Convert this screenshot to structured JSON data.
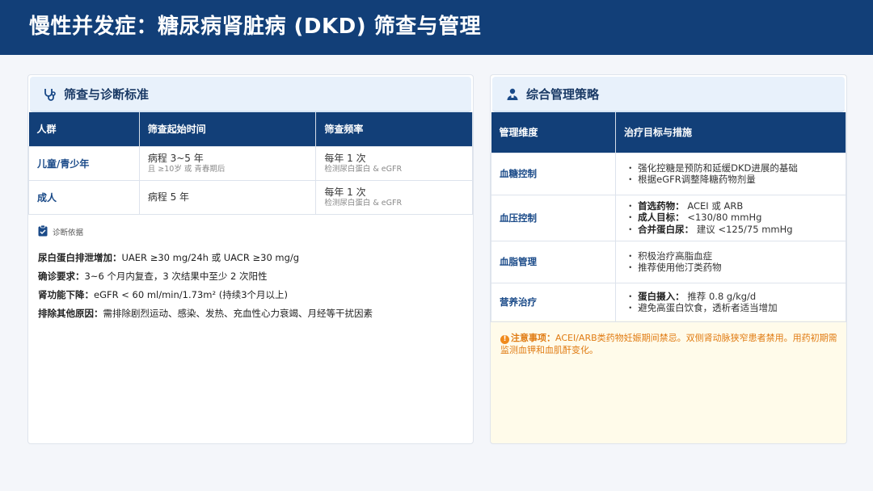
{
  "page_title": "慢性并发症：糖尿病肾脏病 (DKD) 筛查与管理",
  "colors": {
    "header_bg": "#123f78",
    "accent": "#1a4a88",
    "warning": "#e07b12",
    "note_bg": "#fffbea"
  },
  "screening": {
    "title": "筛查与诊断标准",
    "icon": "stethoscope-icon",
    "headers": [
      "人群",
      "筛查起始时间",
      "筛查频率"
    ],
    "rows": [
      {
        "group": "儿童/青少年",
        "start_main": "病程 3~5 年",
        "start_sub": "且 ≥10岁 或 青春期后",
        "freq_main": "每年 1 次",
        "freq_sub": "检测尿白蛋白 & eGFR"
      },
      {
        "group": "成人",
        "start_main": "病程 5 年",
        "start_sub": "",
        "freq_main": "每年 1 次",
        "freq_sub": "检测尿白蛋白 & eGFR"
      }
    ],
    "basis_label": "诊断依据",
    "criteria": [
      {
        "label": "尿白蛋白排泄增加：",
        "text": "UAER ≥30 mg/24h 或 UACR ≥30 mg/g"
      },
      {
        "label": "确诊要求：",
        "text": "3~6 个月内复查，3 次结果中至少 2 次阳性"
      },
      {
        "label": "肾功能下降：",
        "text": "eGFR < 60 ml/min/1.73m² (持续3个月以上)"
      },
      {
        "label": "排除其他原因：",
        "text": "需排除剧烈运动、感染、发热、充血性心力衰竭、月经等干扰因素"
      }
    ]
  },
  "management": {
    "title": "综合管理策略",
    "icon": "person-icon",
    "headers": [
      "管理维度",
      "治疗目标与措施"
    ],
    "rows": [
      {
        "dim": "血糖控制",
        "items": [
          {
            "label": "",
            "text": "强化控糖是预防和延缓DKD进展的基础"
          },
          {
            "label": "",
            "text": "根据eGFR调整降糖药物剂量"
          }
        ]
      },
      {
        "dim": "血压控制",
        "items": [
          {
            "label": "首选药物：",
            "text": "ACEI 或 ARB"
          },
          {
            "label": "成人目标：",
            "text": "<130/80 mmHg"
          },
          {
            "label": "合并蛋白尿：",
            "text": "建议 <125/75 mmHg"
          }
        ]
      },
      {
        "dim": "血脂管理",
        "items": [
          {
            "label": "",
            "text": "积极治疗高脂血症"
          },
          {
            "label": "",
            "text": "推荐使用他汀类药物"
          }
        ]
      },
      {
        "dim": "营养治疗",
        "items": [
          {
            "label": "蛋白摄入：",
            "text": "推荐 0.8 g/kg/d"
          },
          {
            "label": "",
            "text": "避免高蛋白饮食，透析者适当增加"
          }
        ]
      }
    ],
    "note_label": "注意事项：",
    "note_text": "ACEI/ARB类药物妊娠期间禁忌。双侧肾动脉狭窄患者禁用。用药初期需监测血钾和血肌酐变化。"
  }
}
